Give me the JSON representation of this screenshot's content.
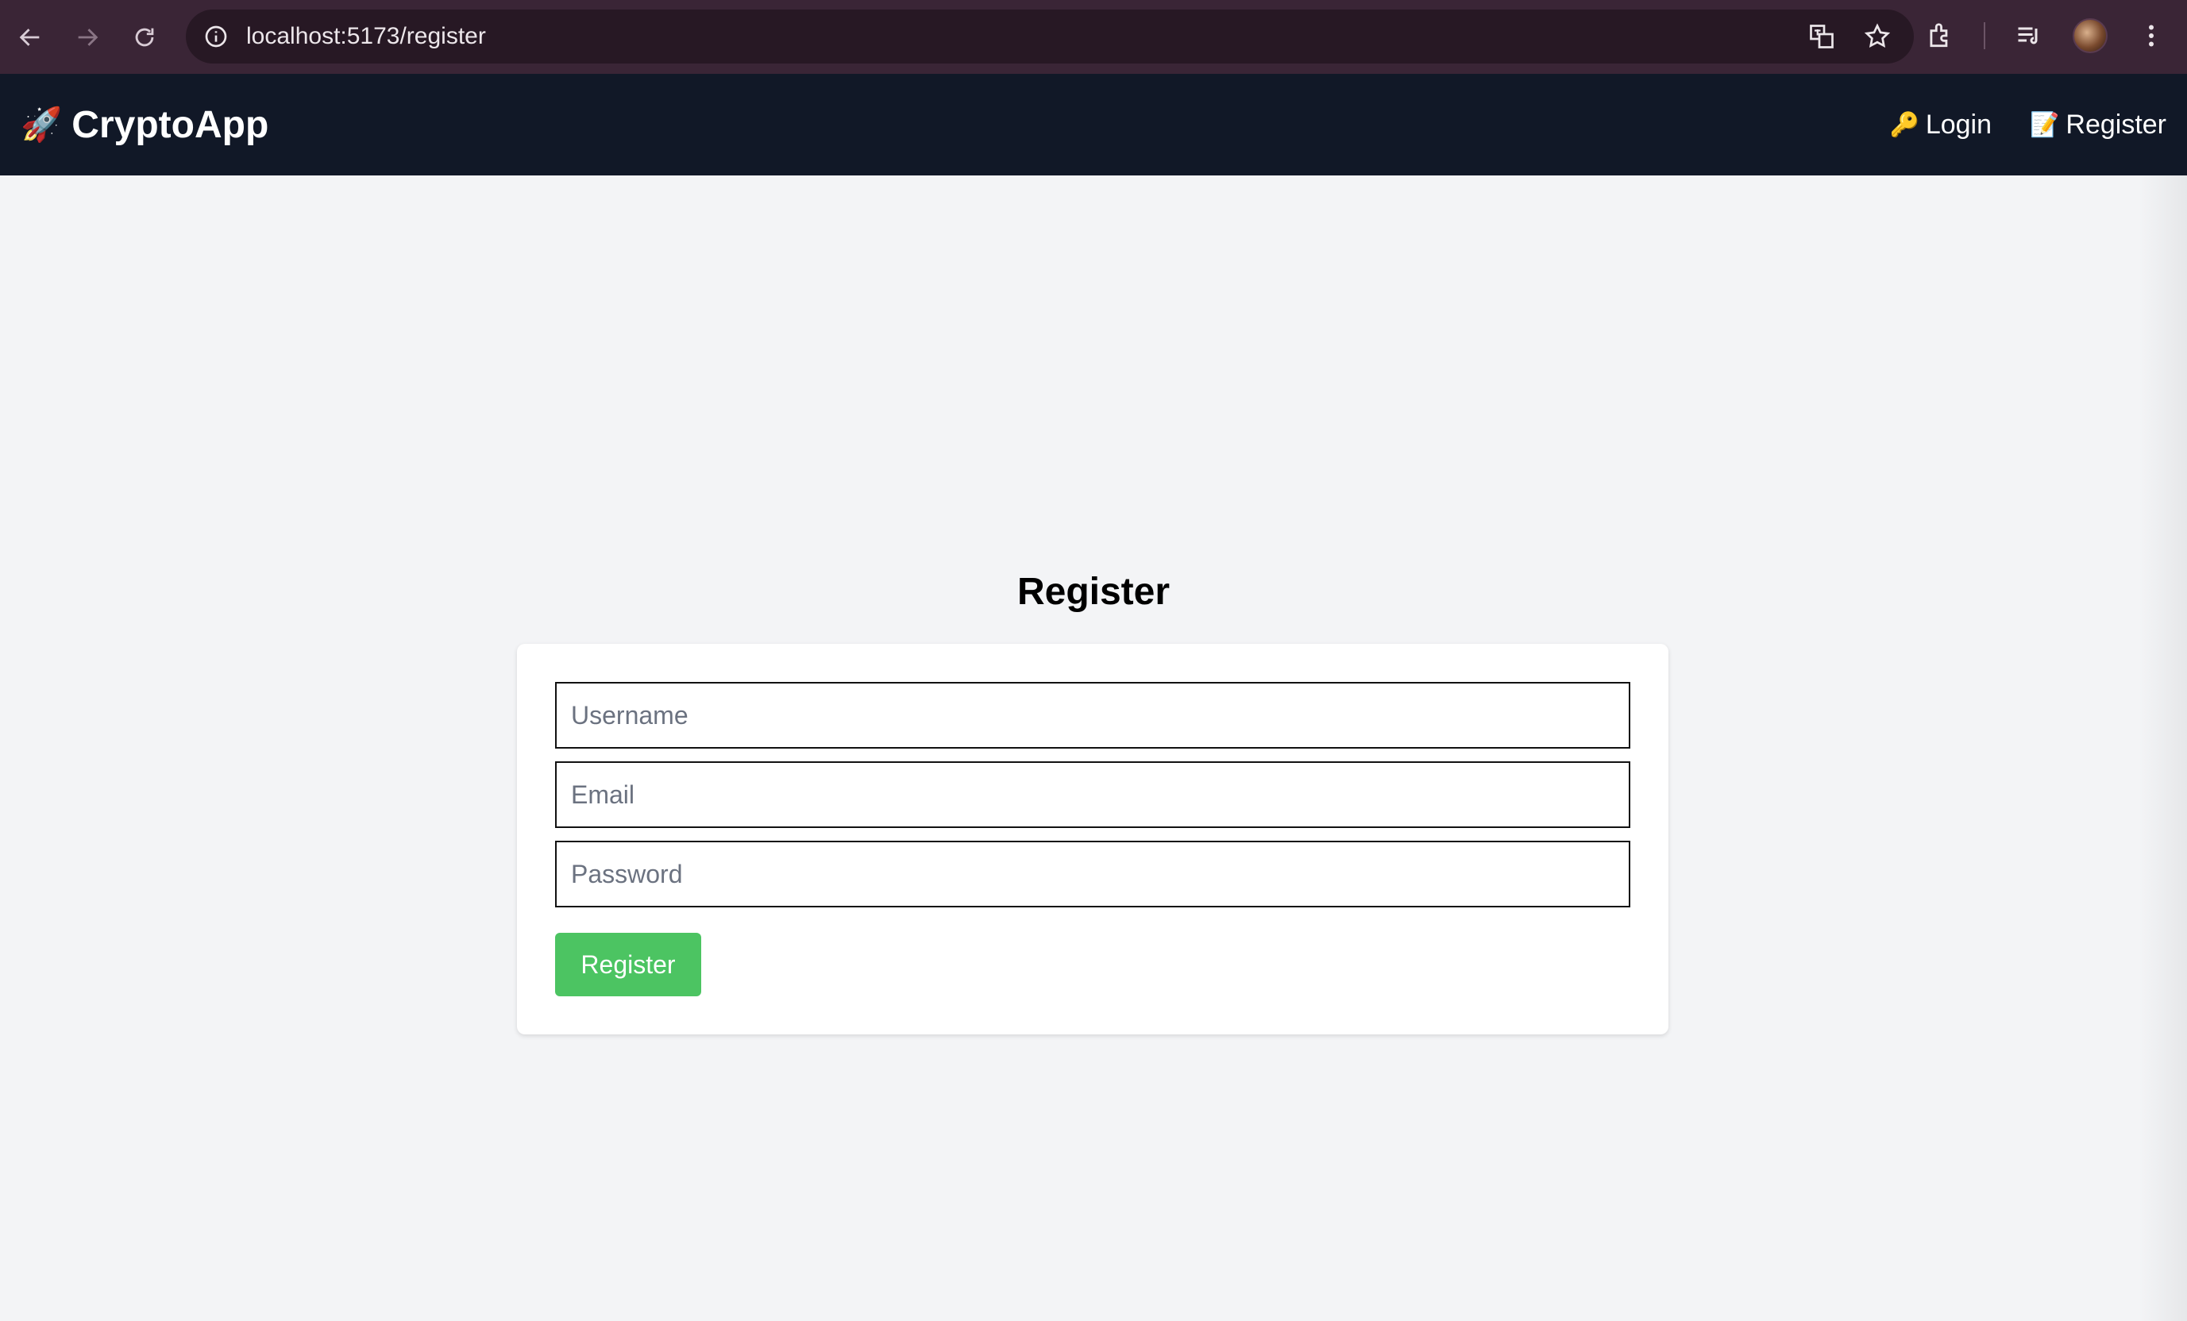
{
  "browser": {
    "url": "localhost:5173/register",
    "icons": [
      "back-arrow-icon",
      "forward-arrow-icon",
      "reload-icon",
      "site-info-icon",
      "translate-icon",
      "bookmark-star-icon",
      "extensions-icon",
      "media-queue-icon",
      "menu-dots-icon"
    ]
  },
  "navbar": {
    "brand_icon": "🚀",
    "brand": "CryptoApp",
    "links": [
      {
        "icon": "🔑",
        "label": "Login"
      },
      {
        "icon": "📝",
        "label": "Register"
      }
    ],
    "background": "#111827"
  },
  "page": {
    "title": "Register",
    "form": {
      "username_placeholder": "Username",
      "email_placeholder": "Email",
      "password_placeholder": "Password",
      "submit_label": "Register"
    },
    "accent_color": "#4cc462",
    "background": "#f3f4f6"
  }
}
